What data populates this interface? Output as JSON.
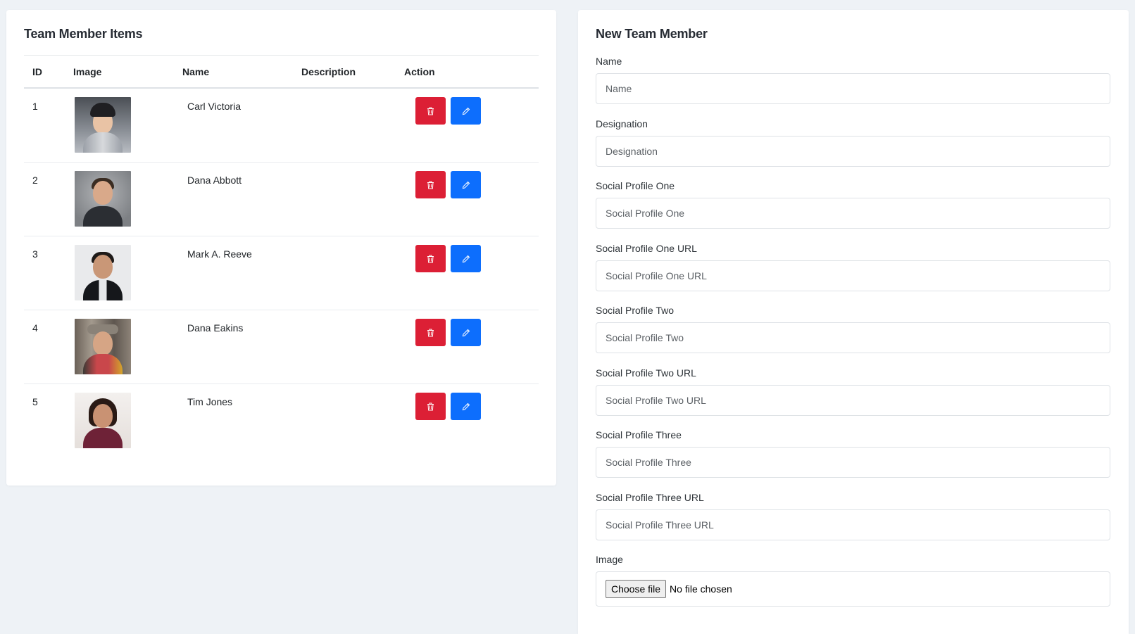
{
  "list": {
    "title": "Team Member Items",
    "columns": [
      "ID",
      "Image",
      "Name",
      "Description",
      "Action"
    ],
    "rows": [
      {
        "id": "1",
        "name": "Carl Victoria",
        "description": "",
        "photo": "woman-in-beanie-photo"
      },
      {
        "id": "2",
        "name": "Dana Abbott",
        "description": "",
        "photo": "man-with-glasses-photo"
      },
      {
        "id": "3",
        "name": "Mark A. Reeve",
        "description": "",
        "photo": "man-in-suit-photo"
      },
      {
        "id": "4",
        "name": "Dana Eakins",
        "description": "",
        "photo": "man-with-hat-photo"
      },
      {
        "id": "5",
        "name": "Tim Jones",
        "description": "",
        "photo": "woman-writing-photo"
      }
    ],
    "actions": {
      "delete_icon": "trash-icon",
      "edit_icon": "pencil-icon"
    }
  },
  "form": {
    "title": "New Team Member",
    "fields": [
      {
        "label": "Name",
        "placeholder": "Name",
        "value": ""
      },
      {
        "label": "Designation",
        "placeholder": "Designation",
        "value": ""
      },
      {
        "label": "Social Profile One",
        "placeholder": "Social Profile One",
        "value": ""
      },
      {
        "label": "Social Profile One URL",
        "placeholder": "Social Profile One URL",
        "value": ""
      },
      {
        "label": "Social Profile Two",
        "placeholder": "Social Profile Two",
        "value": ""
      },
      {
        "label": "Social Profile Two URL",
        "placeholder": "Social Profile Two URL",
        "value": ""
      },
      {
        "label": "Social Profile Three",
        "placeholder": "Social Profile Three",
        "value": ""
      },
      {
        "label": "Social Profile Three URL",
        "placeholder": "Social Profile Three URL",
        "value": ""
      }
    ],
    "image": {
      "label": "Image",
      "button": "Choose file",
      "status": "No file chosen"
    }
  },
  "colors": {
    "delete": "#dc1f35",
    "edit": "#0d6efd",
    "page_background": "#eef2f6"
  }
}
